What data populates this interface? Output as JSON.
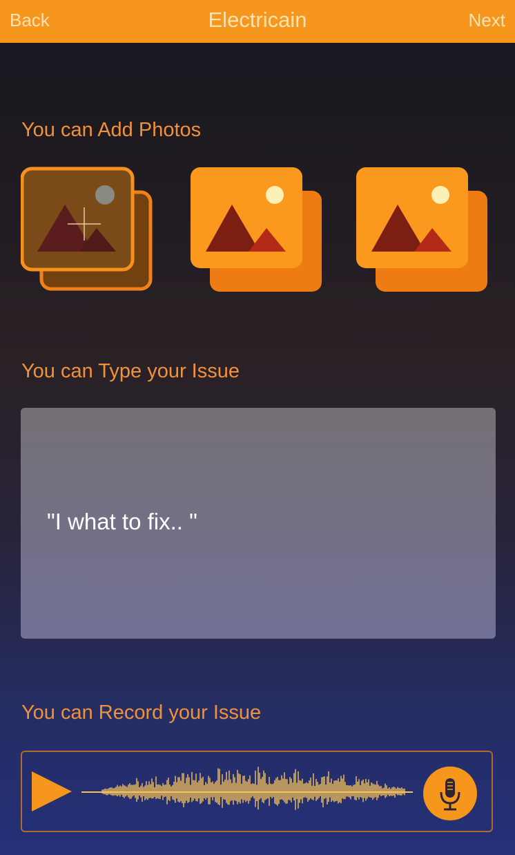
{
  "header": {
    "back_label": "Back",
    "title": "Electricain",
    "next_label": "Next"
  },
  "photos": {
    "label": "You can Add Photos",
    "slots": [
      {
        "state": "add",
        "icon": "add-photo-icon"
      },
      {
        "state": "empty",
        "icon": "image-icon"
      },
      {
        "state": "empty",
        "icon": "image-icon"
      }
    ]
  },
  "type_issue": {
    "label": "You can Type your Issue",
    "placeholder": "\"I what to fix.. \""
  },
  "record_issue": {
    "label": "You can Record your Issue",
    "play_icon": "play-icon",
    "mic_icon": "microphone-icon"
  },
  "colors": {
    "accent": "#f7961d",
    "label": "#f0923a",
    "wave": "#f8c25a"
  }
}
